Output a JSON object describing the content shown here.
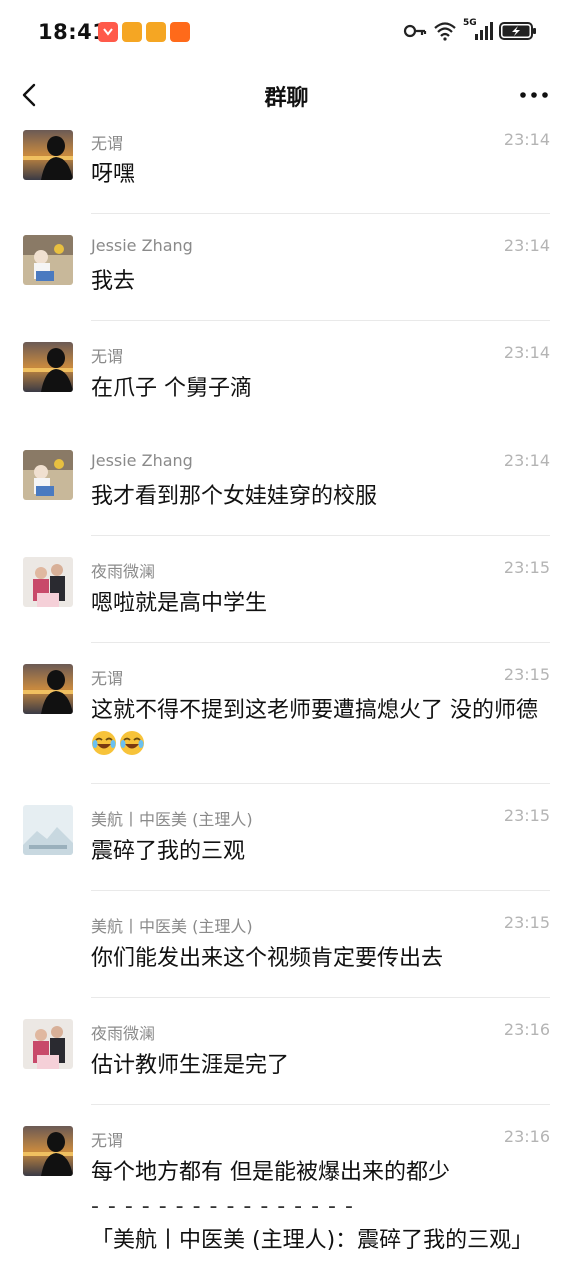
{
  "status_bar": {
    "time": "18:41",
    "network": "5G"
  },
  "header": {
    "title": "群聊"
  },
  "messages": [
    {
      "sender": "无谓",
      "time": "23:14",
      "text": "呀嘿"
    },
    {
      "sender": "Jessie Zhang",
      "time": "23:14",
      "text": "我去"
    },
    {
      "sender": "无谓",
      "time": "23:14",
      "text": "在爪子 个舅子滴"
    },
    {
      "sender": "Jessie Zhang",
      "time": "23:14",
      "text": "我才看到那个女娃娃穿的校服"
    },
    {
      "sender": "夜雨微澜",
      "time": "23:15",
      "text": "嗯啦就是高中学生"
    },
    {
      "sender": "无谓",
      "time": "23:15",
      "text": "这就不得不提到这老师要遭搞熄火了  没的师德"
    },
    {
      "sender": "美航丨中医美 (主理人)",
      "time": "23:15",
      "text": "震碎了我的三观"
    },
    {
      "sender": "美航丨中医美 (主理人)",
      "time": "23:15",
      "text": "你们能发出来这个视频肯定要传出去"
    },
    {
      "sender": "夜雨微澜",
      "time": "23:16",
      "text": "估计教师生涯是完了"
    },
    {
      "sender": "无谓",
      "time": "23:16",
      "text": "每个地方都有  但是能被爆出来的都少",
      "separator": "- - - - - - - - - - - - - - - -",
      "quote": "「美航丨中医美 (主理人)：震碎了我的三观」"
    }
  ],
  "icons": {
    "back": "back-arrow-icon",
    "more": "more-dots-icon",
    "key": "key-icon",
    "wifi": "wifi-icon",
    "signal": "signal-icon",
    "battery": "battery-charging-icon",
    "laugh_emoji": "laugh-cry-emoji-icon"
  },
  "colors": {
    "background": "#ffffff",
    "sender_gray": "#8a8a8a",
    "time_gray": "#b4b4b4",
    "divider": "#e9e9e9"
  }
}
